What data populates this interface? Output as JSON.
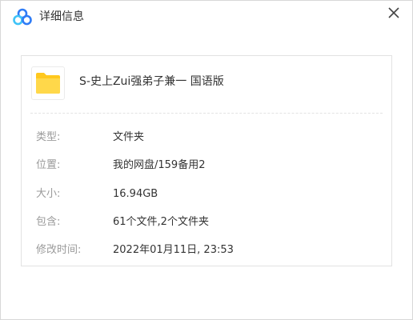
{
  "window": {
    "title": "详细信息",
    "logo_icon": "baidu-netdisk-logo",
    "close_icon": "close-icon"
  },
  "file": {
    "icon": "folder-icon",
    "name": "S-史上Zui强弟子兼一 国语版"
  },
  "details": [
    {
      "label": "类型:",
      "value": "文件夹"
    },
    {
      "label": "位置:",
      "value": "我的网盘/159备用2"
    },
    {
      "label": "大小:",
      "value": "16.94GB"
    },
    {
      "label": "包含:",
      "value": "61个文件,2个文件夹"
    },
    {
      "label": "修改时间:",
      "value": "2022年01月11日, 23:53"
    }
  ],
  "colors": {
    "folder": "#ffd33d",
    "logo_blue": "#2f7cf6",
    "logo_cyan": "#3fc3f7",
    "label": "#9a9a9a",
    "text": "#333333"
  }
}
